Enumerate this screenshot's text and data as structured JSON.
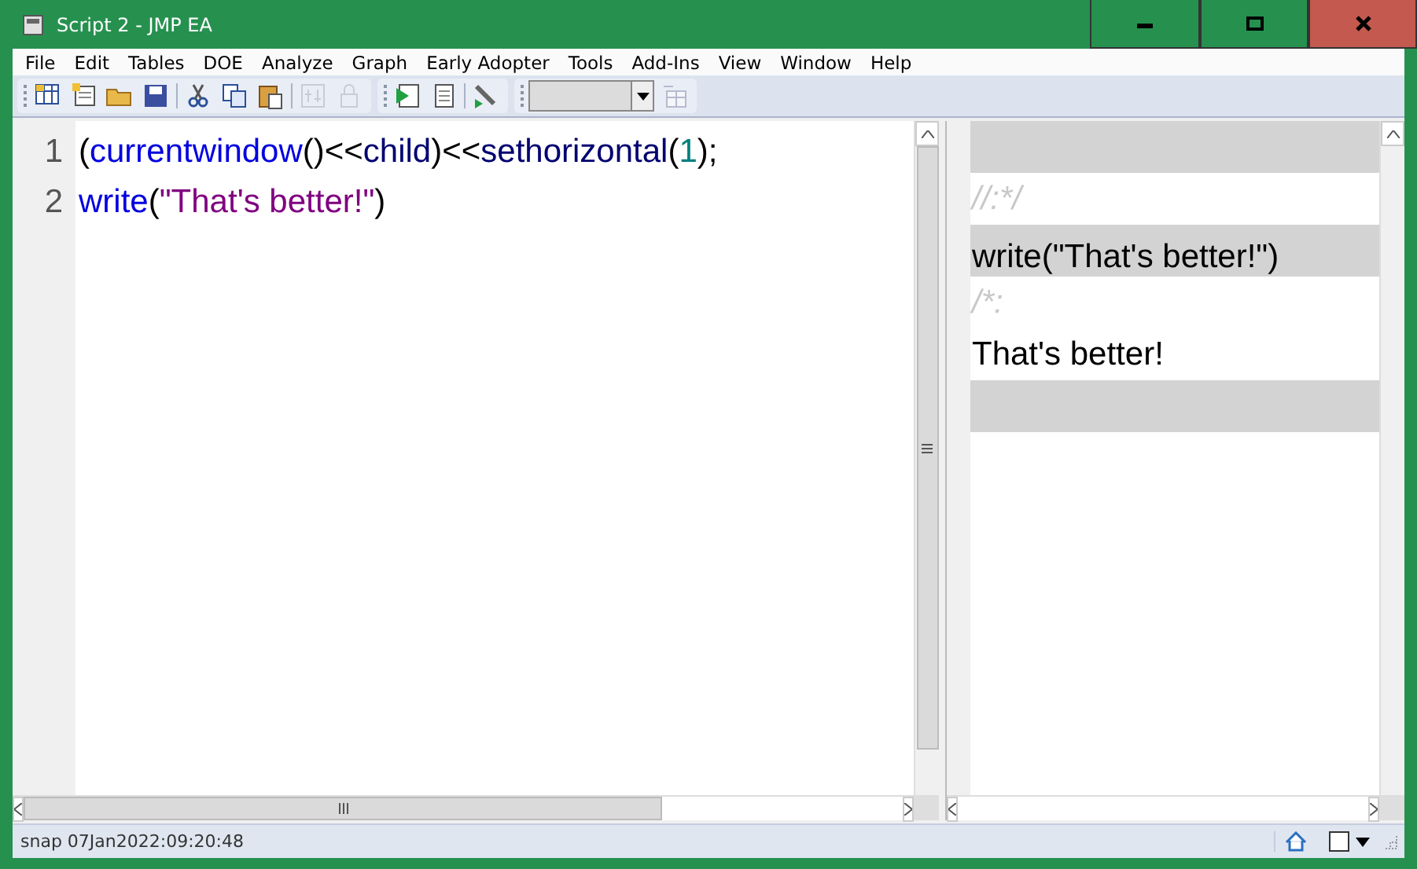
{
  "window": {
    "title": "Script 2 - JMP EA"
  },
  "menu": [
    "File",
    "Edit",
    "Tables",
    "DOE",
    "Analyze",
    "Graph",
    "Early Adopter",
    "Tools",
    "Add-Ins",
    "View",
    "Window",
    "Help"
  ],
  "toolbar": [
    [
      {
        "disabled": false
      },
      {
        "disabled": false
      },
      {
        "disabled": false
      },
      {
        "disabled": false
      },
      {
        "disabled": false
      },
      {
        "disabled": false
      },
      {
        "disabled": false
      },
      {
        "disabled": true
      },
      {
        "disabled": true
      }
    ],
    [
      {
        "disabled": false
      },
      {
        "disabled": false
      },
      {
        "disabled": false
      }
    ],
    [
      {
        "disabled": true
      }
    ]
  ],
  "editor": {
    "lines": [
      {
        "number": "1",
        "tokens": [
          {
            "kind": "punct",
            "text": "("
          },
          {
            "kind": "func",
            "text": "currentwindow"
          },
          {
            "kind": "punct",
            "text": "()<<"
          },
          {
            "kind": "name",
            "text": "child"
          },
          {
            "kind": "punct",
            "text": ")<<"
          },
          {
            "kind": "name",
            "text": "sethorizontal"
          },
          {
            "kind": "punct",
            "text": "("
          },
          {
            "kind": "number",
            "text": "1"
          },
          {
            "kind": "punct",
            "text": ");"
          }
        ]
      },
      {
        "number": "2",
        "tokens": [
          {
            "kind": "func",
            "text": "write"
          },
          {
            "kind": "punct",
            "text": "("
          },
          {
            "kind": "string",
            "text": "\"That's better!\""
          },
          {
            "kind": "punct",
            "text": ")"
          }
        ]
      }
    ]
  },
  "output": [
    {
      "kind": "band"
    },
    {
      "kind": "comment",
      "text": "//:*/"
    },
    {
      "kind": "code",
      "text": "write(\"That's better!\")"
    },
    {
      "kind": "comment",
      "text": "/*:"
    },
    {
      "kind": "text",
      "text": "That's better!"
    },
    {
      "kind": "band"
    }
  ],
  "status_bar": {
    "text": "snap 07Jan2022:09:20:48",
    "checkbox": {
      "checked": false
    }
  }
}
